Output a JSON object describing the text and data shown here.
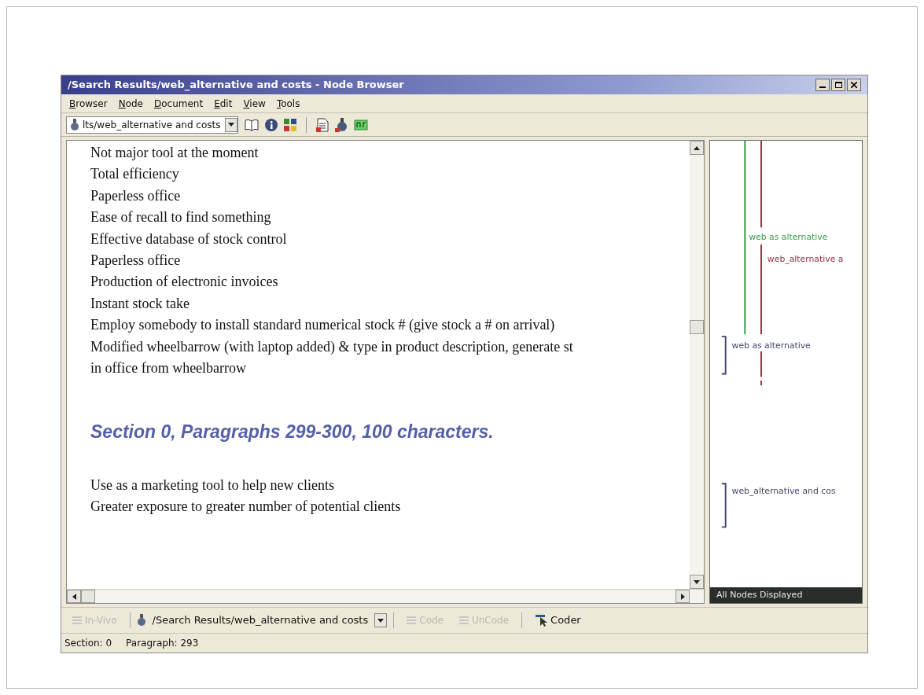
{
  "window": {
    "title": "/Search Results/web_alternative and costs - Node Browser"
  },
  "menu": [
    "Browser",
    "Node",
    "Document",
    "Edit",
    "View",
    "Tools"
  ],
  "toolbar": {
    "node_combo": "lts/web_alternative and costs"
  },
  "document": {
    "lines": [
      "Not major tool at the moment",
      "Total efficiency",
      "Paperless office",
      "Ease of recall  to find something",
      "Effective database of stock control",
      "Paperless office",
      "Production of electronic invoices",
      "Instant stock take",
      "Employ somebody to install standard numerical stock # (give stock a # on arrival)",
      "Modified wheelbarrow (with laptop added) & type in product description, generate st",
      "in office from wheelbarrow"
    ],
    "section_heading": "Section 0, Paragraphs 299-300, 100 characters.",
    "lines_after": [
      "Use as a marketing tool to help new clients",
      "Greater exposure to greater number of potential clients"
    ]
  },
  "coding_stripes": [
    {
      "kind": "bar",
      "label": "web as alternative",
      "color": "#3a9a4a"
    },
    {
      "kind": "bar",
      "label": "web_alternative a",
      "color": "#9a3040"
    },
    {
      "kind": "bracket",
      "label": "web as alternative",
      "color": "#404870"
    },
    {
      "kind": "bracket",
      "label": "web_alternative and cos",
      "color": "#404870"
    }
  ],
  "stripes_footer": "All Nodes Displayed",
  "coding_bar": [
    {
      "kind": "button",
      "label": "In-Vivo",
      "disabled": true
    },
    {
      "kind": "combo",
      "label": "/Search Results/web_alternative and costs",
      "disabled": false
    },
    {
      "kind": "button",
      "label": "Code",
      "disabled": true
    },
    {
      "kind": "button",
      "label": "UnCode",
      "disabled": true
    },
    {
      "kind": "coder",
      "label": "Coder",
      "disabled": false
    }
  ],
  "status_bar": {
    "section": "Section: 0",
    "paragraph": "Paragraph: 293"
  }
}
